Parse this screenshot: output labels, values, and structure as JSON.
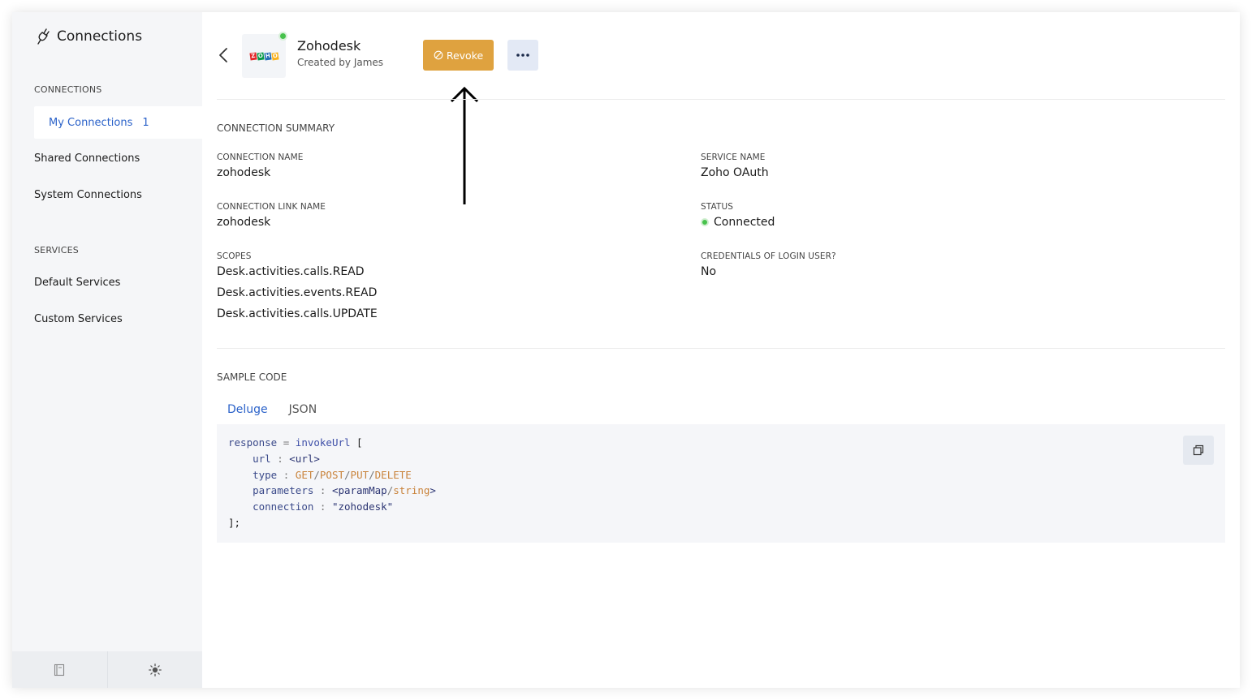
{
  "sidebar": {
    "title": "Connections",
    "connections_label": "CONNECTIONS",
    "items": [
      {
        "label": "My Connections",
        "count": "1"
      },
      {
        "label": "Shared Connections"
      },
      {
        "label": "System Connections"
      }
    ],
    "services_label": "SERVICES",
    "service_items": [
      {
        "label": "Default Services"
      },
      {
        "label": "Custom Services"
      }
    ]
  },
  "header": {
    "app_name": "Zohodesk",
    "created_by": "Created by James",
    "revoke_label": "Revoke",
    "logo_letters": [
      "Z",
      "O",
      "H",
      "O"
    ]
  },
  "summary": {
    "title": "CONNECTION SUMMARY",
    "connection_name_label": "CONNECTION NAME",
    "connection_name": "zohodesk",
    "service_name_label": "SERVICE NAME",
    "service_name": "Zoho OAuth",
    "link_name_label": "CONNECTION LINK NAME",
    "link_name": "zohodesk",
    "status_label": "STATUS",
    "status": "Connected",
    "scopes_label": "SCOPES",
    "scopes": [
      "Desk.activities.calls.READ",
      "Desk.activities.events.READ",
      "Desk.activities.calls.UPDATE"
    ],
    "credentials_label": "CREDENTIALS OF LOGIN USER?",
    "credentials": "No"
  },
  "sample_code": {
    "title": "SAMPLE CODE",
    "tabs": [
      "Deluge",
      "JSON"
    ],
    "active_tab": "Deluge",
    "lines": {
      "l1_var": "response",
      "l1_eq": " = ",
      "l1_fn": "invokeUrl",
      "l1_br": " [",
      "l2_key": "url",
      "l2_val": "<url>",
      "l3_key": "type",
      "l3_v1": "GET",
      "l3_v2": "POST",
      "l3_v3": "PUT",
      "l3_v4": "DELETE",
      "l4_key": "parameters",
      "l4_v1": "<paramMap",
      "l4_v2": "string",
      "l4_v3": ">",
      "l5_key": "connection",
      "l5_val": "\"zohodesk\"",
      "l6": "];"
    }
  },
  "colors": {
    "accent": "#2b62c9",
    "revoke": "#dfa23f",
    "status_green": "#47c24c"
  }
}
